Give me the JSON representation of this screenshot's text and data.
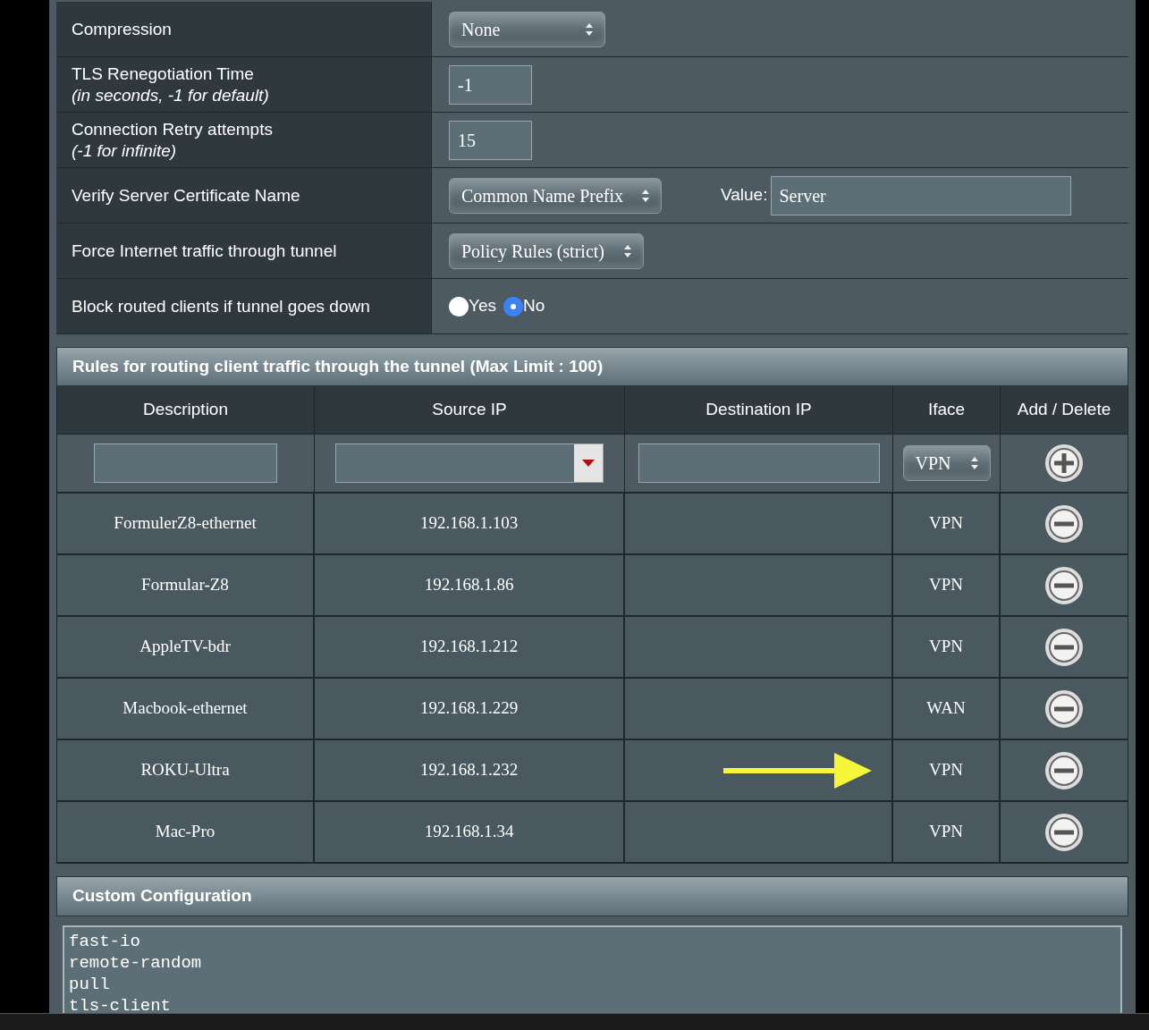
{
  "settings": [
    {
      "kind": "select",
      "label": "Compression",
      "value": "None"
    },
    {
      "kind": "text",
      "label": "TLS Renegotiation Time",
      "note": "(in seconds, -1 for default)",
      "value": "-1"
    },
    {
      "kind": "text",
      "label": "Connection Retry attempts",
      "note": "(-1 for infinite)",
      "value": "15"
    },
    {
      "kind": "select_value",
      "label": "Verify Server Certificate Name",
      "value": "Common Name Prefix",
      "value_label": "Value:",
      "value_text": "Server"
    },
    {
      "kind": "select",
      "label": "Force Internet traffic through tunnel",
      "value": "Policy Rules (strict)"
    },
    {
      "kind": "radio",
      "label": "Block routed clients if tunnel goes down",
      "options": [
        {
          "label": "Yes",
          "selected": false
        },
        {
          "label": "No",
          "selected": true
        }
      ]
    }
  ],
  "rules": {
    "title": "Rules for routing client traffic through the tunnel (Max Limit : 100)",
    "columns": [
      "Description",
      "Source IP",
      "Destination IP",
      "Iface",
      "Add / Delete"
    ],
    "new_row": {
      "iface": "VPN"
    },
    "rows": [
      {
        "description": "FormulerZ8-ethernet",
        "source_ip": "192.168.1.103",
        "iface": "VPN",
        "marked": false
      },
      {
        "description": "Formular-Z8",
        "source_ip": "192.168.1.86",
        "iface": "VPN",
        "marked": false
      },
      {
        "description": "AppleTV-bdr",
        "source_ip": "192.168.1.212",
        "iface": "VPN",
        "marked": false
      },
      {
        "description": "Macbook-ethernet",
        "source_ip": "192.168.1.229",
        "iface": "WAN",
        "marked": false
      },
      {
        "description": "ROKU-Ultra",
        "source_ip": "192.168.1.232",
        "iface": "VPN",
        "marked": true
      },
      {
        "description": "Mac-Pro",
        "source_ip": "192.168.1.34",
        "iface": "VPN",
        "marked": false
      }
    ]
  },
  "custom": {
    "title": "Custom Configuration",
    "lines": [
      "fast-io",
      "remote-random",
      "pull",
      "tls-client"
    ]
  }
}
